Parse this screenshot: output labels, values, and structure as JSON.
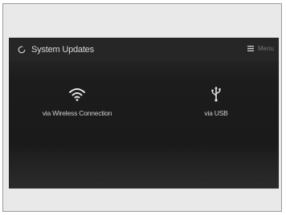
{
  "header": {
    "title": "System Updates",
    "menu_label": "Menu",
    "title_icon": "refresh-circle-icon",
    "menu_icon": "hamburger-menu-icon"
  },
  "options": [
    {
      "label": "via Wireless Connection",
      "icon": "wifi-icon"
    },
    {
      "label": "via USB",
      "icon": "usb-icon"
    }
  ],
  "colors": {
    "screen_background": "#1c1c1c",
    "text": "#d8d8d8",
    "page_background": "#e9e9e9"
  }
}
